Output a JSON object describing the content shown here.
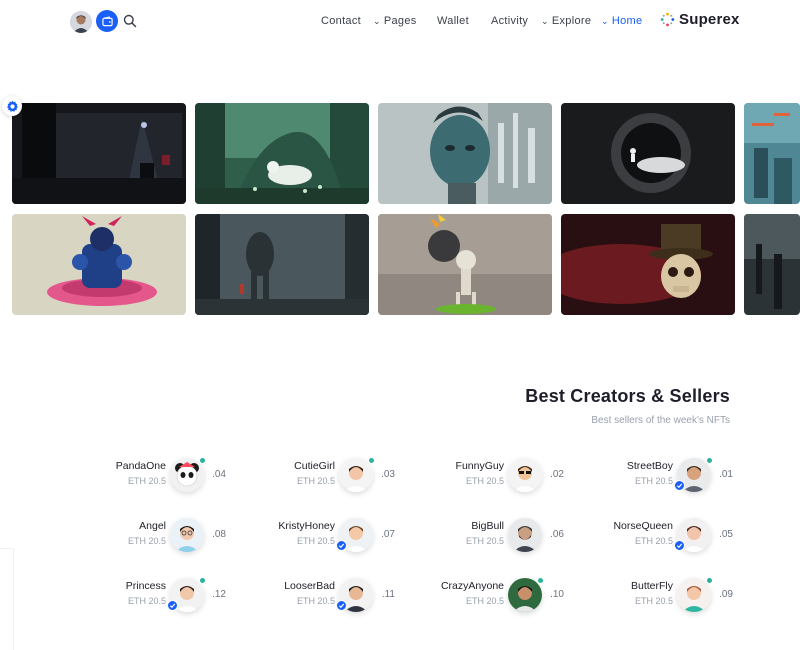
{
  "header": {
    "nav": [
      {
        "label": "Contact",
        "chevron": false,
        "active": false
      },
      {
        "label": "Pages",
        "chevron": true,
        "active": false
      },
      {
        "label": "Wallet",
        "chevron": false,
        "active": false
      },
      {
        "label": "Activity",
        "chevron": false,
        "active": false
      },
      {
        "label": "Explore",
        "chevron": true,
        "active": false
      },
      {
        "label": "Home",
        "chevron": true,
        "active": true
      }
    ],
    "brand": "Superex",
    "icons": {
      "wallet": "wallet-icon",
      "search": "search-icon",
      "gear": "gear-icon"
    }
  },
  "colors": {
    "accent": "#1a5ff7",
    "online": "#2bb39d",
    "muted": "#9aa1ad"
  },
  "section": {
    "title": "Best Creators & Sellers",
    "subtitle": "Best sellers of the week's NFTs"
  },
  "creators": [
    {
      "name": "PandaOne",
      "eth": "ETH 20.5",
      "rank": ".04",
      "online": true,
      "verified": false
    },
    {
      "name": "CutieGirl",
      "eth": "ETH 20.5",
      "rank": ".03",
      "online": true,
      "verified": false
    },
    {
      "name": "FunnyGuy",
      "eth": "ETH 20.5",
      "rank": ".02",
      "online": false,
      "verified": false
    },
    {
      "name": "StreetBoy",
      "eth": "ETH 20.5",
      "rank": ".01",
      "online": true,
      "verified": true
    },
    {
      "name": "Angel",
      "eth": "ETH 20.5",
      "rank": ".08",
      "online": false,
      "verified": false
    },
    {
      "name": "KristyHoney",
      "eth": "ETH 20.5",
      "rank": ".07",
      "online": false,
      "verified": true
    },
    {
      "name": "BigBull",
      "eth": "ETH 20.5",
      "rank": ".06",
      "online": false,
      "verified": false
    },
    {
      "name": "NorseQueen",
      "eth": "ETH 20.5",
      "rank": ".05",
      "online": false,
      "verified": true
    },
    {
      "name": "Princess",
      "eth": "ETH 20.5",
      "rank": ".12",
      "online": true,
      "verified": true
    },
    {
      "name": "LooserBad",
      "eth": "ETH 20.5",
      "rank": ".11",
      "online": false,
      "verified": true
    },
    {
      "name": "CrazyAnyone",
      "eth": "ETH 20.5",
      "rank": ".10",
      "online": true,
      "verified": false
    },
    {
      "name": "ButterFly",
      "eth": "ETH 20.5",
      "rank": ".09",
      "online": true,
      "verified": false
    }
  ]
}
